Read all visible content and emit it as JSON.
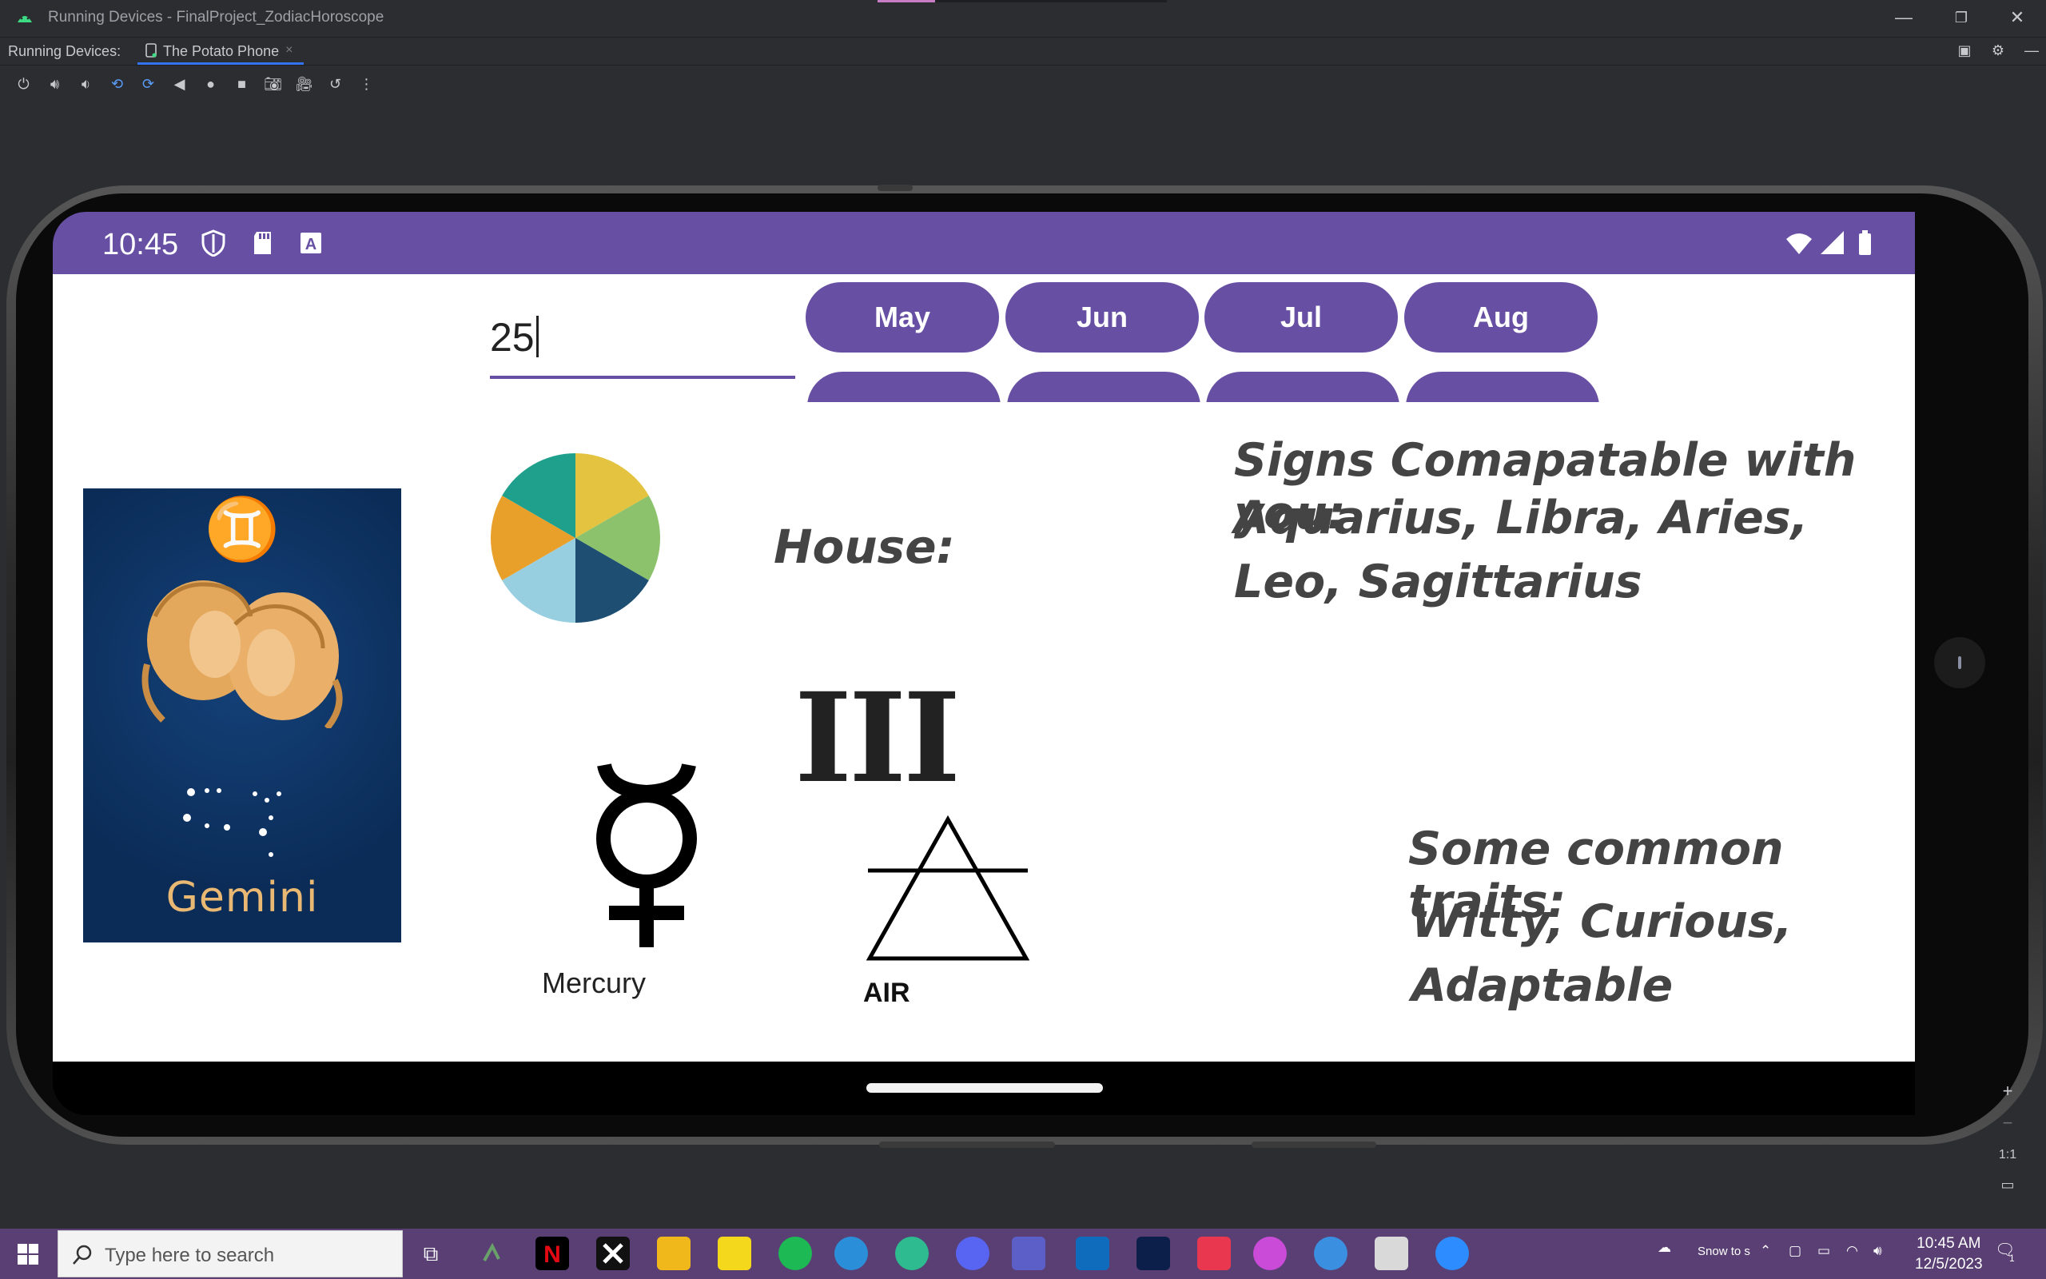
{
  "window": {
    "title": "Running Devices - FinalProject_ZodiacHoroscope",
    "minimize": "—",
    "restore": "❐",
    "close": "✕"
  },
  "tabbar": {
    "label": "Running Devices:",
    "device_tab": "The Potato Phone",
    "close_icon": "×"
  },
  "device": {
    "status": {
      "time": "10:45"
    },
    "app": {
      "day_input": "25",
      "months_row1": [
        "May",
        "Jun",
        "Jul",
        "Aug"
      ],
      "sign_card": {
        "glyph": "♊",
        "name": "Gemini"
      },
      "house_title": "House:",
      "house_number": "III",
      "planet_label": "Mercury",
      "element_label": "AIR",
      "compat_title": "Signs Comapatable with you:",
      "compat_list": "Aquarius, Libra, Aries, Leo, Sagittarius",
      "traits_title": "Some common traits:",
      "traits_list": "Witty, Curious, Adaptable"
    }
  },
  "zoom": {
    "plus": "+",
    "minus": "−",
    "one_to_one": "1:1"
  },
  "taskbar": {
    "search_placeholder": "Type here to search",
    "weather": "Snow to s",
    "time": "10:45 AM",
    "date": "12/5/2023",
    "notification_count": "1"
  },
  "colors": {
    "accent": "#6750a4",
    "card_bg": "#0b2c57",
    "card_text": "#e9b873",
    "taskbar": "#5a3f74"
  }
}
